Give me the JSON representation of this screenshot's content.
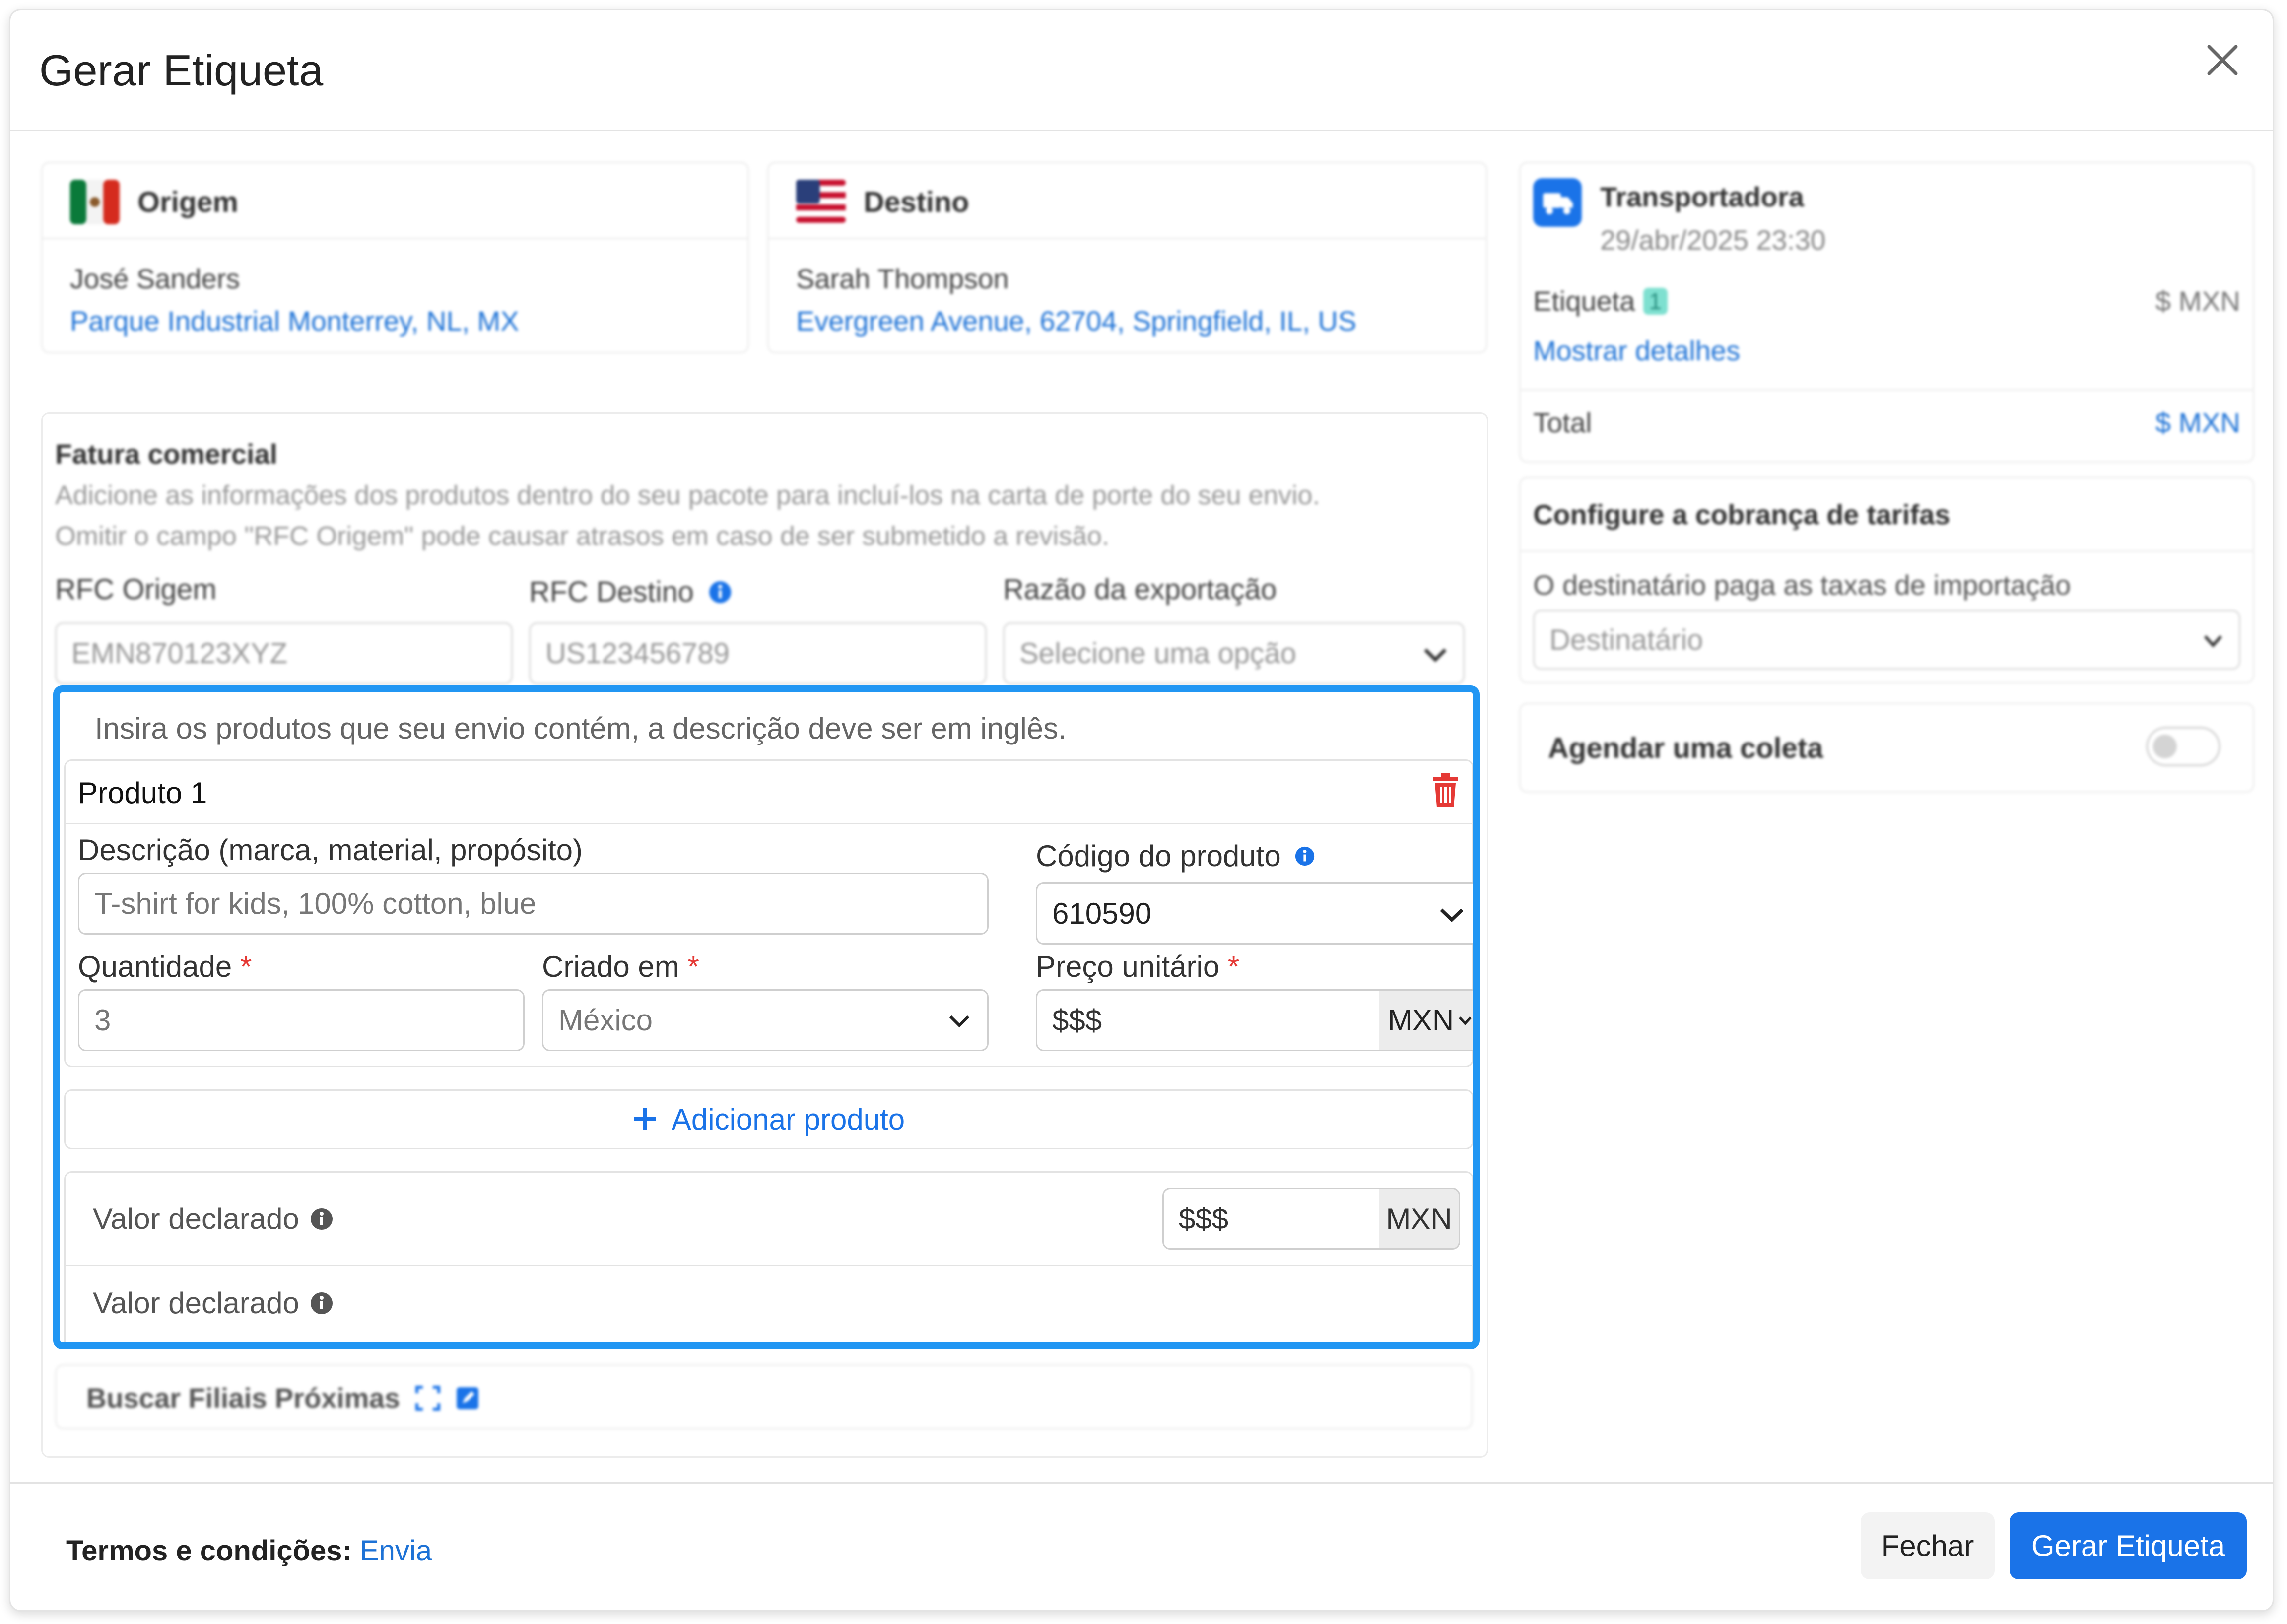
{
  "modal": {
    "title": "Gerar Etiqueta"
  },
  "origin": {
    "heading": "Origem",
    "name": "José Sanders",
    "address": "Parque Industrial Monterrey, NL, MX"
  },
  "destination": {
    "heading": "Destino",
    "name": "Sarah Thompson",
    "address": "Evergreen Avenue, 62704, Springfield, IL, US"
  },
  "carrier": {
    "heading": "Transportadora",
    "date": "29/abr/2025 23:30",
    "label_text": "Etiqueta",
    "label_badge": "1",
    "label_price": "$ MXN",
    "details_link": "Mostrar detalhes",
    "total_label": "Total",
    "total_value": "$ MXN"
  },
  "tariffs": {
    "heading": "Configure a cobrança de tarifas",
    "label": "O destinatário paga as taxas de importação",
    "select_value": "Destinatário"
  },
  "pickup": {
    "label": "Agendar uma coleta"
  },
  "invoice": {
    "heading": "Fatura comercial",
    "description_line1": "Adicione as informações dos produtos dentro do seu pacote para incluí-los na carta de porte do seu envio.",
    "description_line2": "Omitir o campo \"RFC Origem\" pode causar atrasos em caso de ser submetido a revisão.",
    "rfc_origin_label": "RFC Origem",
    "rfc_origin_value": "EMN870123XYZ",
    "rfc_dest_label": "RFC Destino",
    "rfc_dest_value": "US123456789",
    "export_reason_label": "Razão da exportação",
    "export_reason_placeholder": "Selecione uma opção"
  },
  "products": {
    "instruction": "Insira os produtos que seu envio contém, a descrição deve ser em inglês.",
    "product_title": "Produto 1",
    "description_label": "Descrição (marca, material, propósito)",
    "description_placeholder": "T-shirt for kids, 100% cotton, blue",
    "code_label": "Código do produto",
    "code_value": "610590",
    "quantity_label": "Quantidade",
    "quantity_value": "3",
    "origin_label": "Criado em",
    "origin_value": "México",
    "price_label": "Preço unitário",
    "price_placeholder": "$$$",
    "price_currency": "MXN",
    "required_mark": "*",
    "add_product": "Adicionar produto",
    "declared_value_label": "Valor declarado",
    "declared_value_placeholder": "$$$",
    "declared_currency": "MXN",
    "declared_value_label_2": "Valor declarado"
  },
  "nearby": {
    "label": "Buscar Filiais Próximas"
  },
  "footer": {
    "terms_label": "Termos e condições:",
    "terms_link": "Envia",
    "close_button": "Fechar",
    "submit_button": "Gerar Etiqueta"
  },
  "colors": {
    "accent": "#1a73e8",
    "highlight": "#2196f3",
    "required": "#e53935",
    "delete": "#e53935"
  }
}
